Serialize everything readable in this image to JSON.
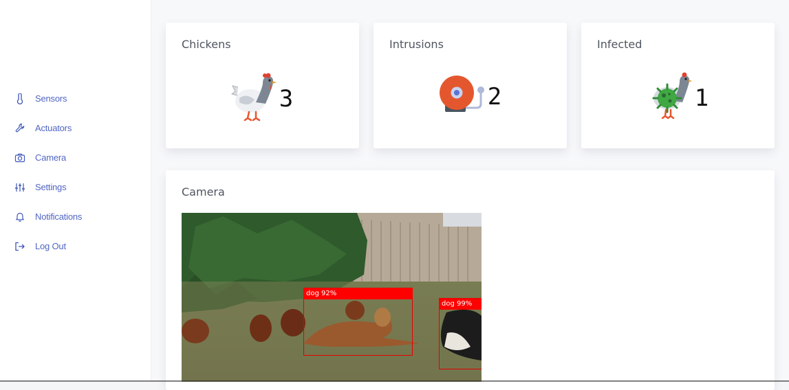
{
  "sidebar": {
    "items": [
      {
        "label": "Sensors",
        "icon": "thermometer-icon"
      },
      {
        "label": "Actuators",
        "icon": "wrench-icon"
      },
      {
        "label": "Camera",
        "icon": "camera-icon"
      },
      {
        "label": "Settings",
        "icon": "sliders-icon"
      },
      {
        "label": "Notifications",
        "icon": "bell-icon"
      },
      {
        "label": "Log Out",
        "icon": "logout-icon"
      }
    ],
    "accent": "#4a63c8"
  },
  "cards": {
    "chickens": {
      "title": "Chickens",
      "value": "3",
      "icon": "chicken-icon"
    },
    "intrusions": {
      "title": "Intrusions",
      "value": "2",
      "icon": "alarm-bell-icon"
    },
    "infected": {
      "title": "Infected",
      "value": "1",
      "icon": "infected-chicken-icon"
    }
  },
  "camera": {
    "title": "Camera",
    "detections": [
      {
        "label": "dog 92%"
      },
      {
        "label": "dog 99%"
      }
    ],
    "box_color": "#ff0000"
  }
}
